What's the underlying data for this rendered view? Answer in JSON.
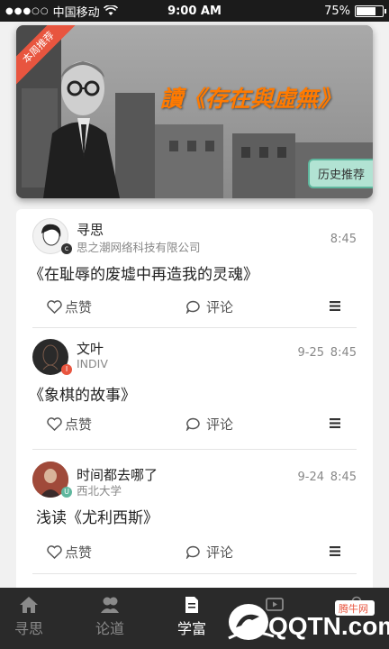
{
  "status_bar": {
    "carrier": "中国移动",
    "time": "9:00 AM",
    "battery": "75%"
  },
  "banner": {
    "ribbon": "本周推荐",
    "title": "讀《存在與虛無》",
    "history_button": "历史推荐"
  },
  "posts": [
    {
      "name": "寻思",
      "org": "思之潮网络科技有限公司",
      "date": "",
      "time": "8:45",
      "text": "《在耻辱的废墟中再造我的灵魂》",
      "badge": "c"
    },
    {
      "name": "文叶",
      "org": "INDIV",
      "date": "9-25",
      "time": "8:45",
      "text": "《象棋的故事》",
      "badge": "I"
    },
    {
      "name": "时间都去哪了",
      "org": "西北大学",
      "date": "9-24",
      "time": "8:45",
      "text": "浅读《尤利西斯》",
      "badge": "U"
    }
  ],
  "actions": {
    "like": "点赞",
    "comment": "评论"
  },
  "tabs": [
    {
      "label": "寻思"
    },
    {
      "label": "论道"
    },
    {
      "label": "学富"
    },
    {
      "label": ""
    },
    {
      "label": ""
    }
  ],
  "watermark": {
    "brand": "QQTN.com",
    "tag": "腾牛网"
  },
  "colors": {
    "ribbon": "#e8553f",
    "title": "#ff7a00",
    "history_bg": "#b2e3d3",
    "tabbar": "#2a2a2a"
  }
}
